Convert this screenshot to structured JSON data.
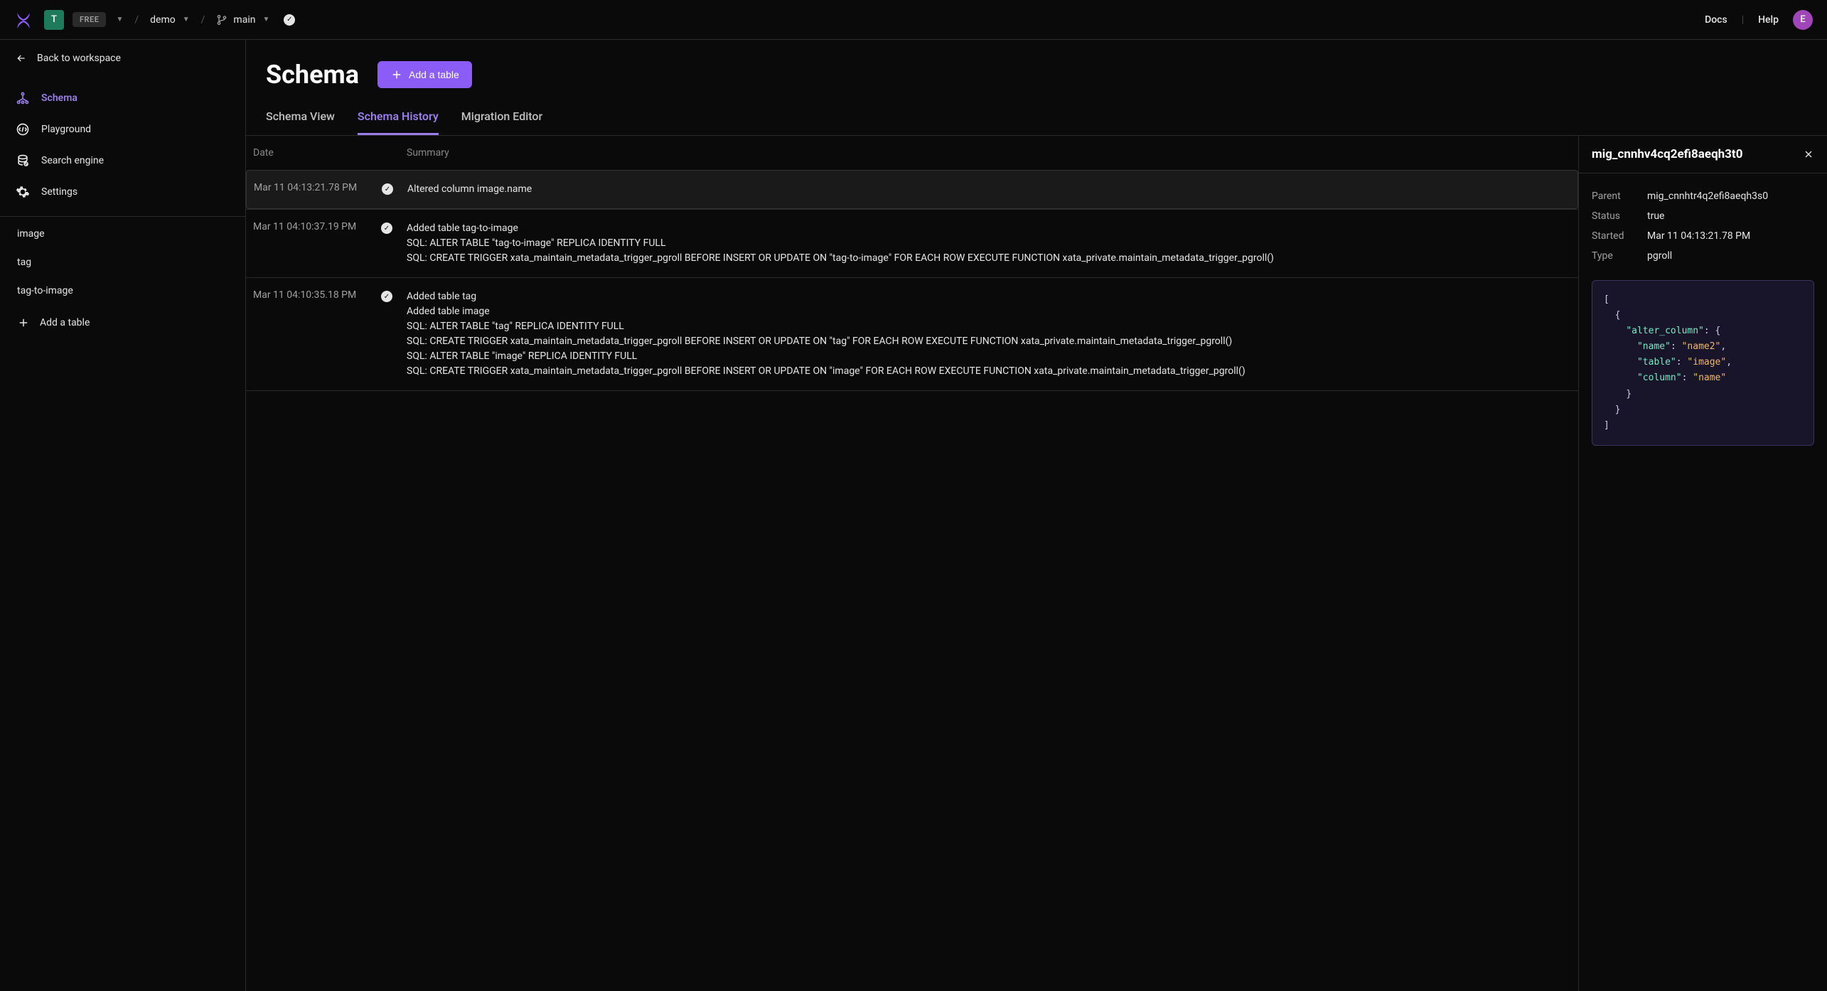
{
  "topbar": {
    "workspace_initial": "T",
    "plan": "FREE",
    "database": "demo",
    "branch": "main",
    "docs": "Docs",
    "help": "Help",
    "avatar_initial": "E"
  },
  "sidebar": {
    "back": "Back to workspace",
    "nav": [
      {
        "id": "schema",
        "label": "Schema",
        "active": true
      },
      {
        "id": "playground",
        "label": "Playground",
        "active": false
      },
      {
        "id": "search",
        "label": "Search engine",
        "active": false
      },
      {
        "id": "settings",
        "label": "Settings",
        "active": false
      }
    ],
    "tables": [
      "image",
      "tag",
      "tag-to-image"
    ],
    "add_table": "Add a table"
  },
  "main": {
    "title": "Schema",
    "add_table_btn": "Add a table",
    "tabs": [
      {
        "id": "view",
        "label": "Schema View",
        "active": false
      },
      {
        "id": "history",
        "label": "Schema History",
        "active": true
      },
      {
        "id": "migration",
        "label": "Migration Editor",
        "active": false
      }
    ]
  },
  "history": {
    "headers": {
      "date": "Date",
      "summary": "Summary"
    },
    "rows": [
      {
        "date": "Mar 11 04:13:21.78 PM",
        "summary": "Altered column image.name",
        "selected": true
      },
      {
        "date": "Mar 11 04:10:37.19 PM",
        "summary": "Added table tag-to-image\nSQL: ALTER TABLE \"tag-to-image\" REPLICA IDENTITY FULL\nSQL: CREATE TRIGGER xata_maintain_metadata_trigger_pgroll BEFORE INSERT OR UPDATE ON \"tag-to-image\" FOR EACH ROW EXECUTE FUNCTION xata_private.maintain_metadata_trigger_pgroll()",
        "selected": false
      },
      {
        "date": "Mar 11 04:10:35.18 PM",
        "summary": "Added table tag\nAdded table image\nSQL: ALTER TABLE \"tag\" REPLICA IDENTITY FULL\nSQL: CREATE TRIGGER xata_maintain_metadata_trigger_pgroll BEFORE INSERT OR UPDATE ON \"tag\" FOR EACH ROW EXECUTE FUNCTION xata_private.maintain_metadata_trigger_pgroll()\nSQL: ALTER TABLE \"image\" REPLICA IDENTITY FULL\nSQL: CREATE TRIGGER xata_maintain_metadata_trigger_pgroll BEFORE INSERT OR UPDATE ON \"image\" FOR EACH ROW EXECUTE FUNCTION xata_private.maintain_metadata_trigger_pgroll()",
        "selected": false
      }
    ]
  },
  "detail": {
    "title": "mig_cnnhv4cq2efi8aeqh3t0",
    "props": [
      {
        "label": "Parent",
        "value": "mig_cnnhtr4q2efi8aeqh3s0"
      },
      {
        "label": "Status",
        "value": "true"
      },
      {
        "label": "Started",
        "value": "Mar 11 04:13:21.78 PM"
      },
      {
        "label": "Type",
        "value": "pgroll"
      }
    ],
    "code_tokens": [
      {
        "t": "punc",
        "v": "["
      },
      {
        "t": "nl"
      },
      {
        "t": "pad",
        "v": "  "
      },
      {
        "t": "punc",
        "v": "{"
      },
      {
        "t": "nl"
      },
      {
        "t": "pad",
        "v": "    "
      },
      {
        "t": "key",
        "v": "\"alter_column\""
      },
      {
        "t": "punc",
        "v": ": {"
      },
      {
        "t": "nl"
      },
      {
        "t": "pad",
        "v": "      "
      },
      {
        "t": "key",
        "v": "\"name\""
      },
      {
        "t": "punc",
        "v": ": "
      },
      {
        "t": "str",
        "v": "\"name2\""
      },
      {
        "t": "punc",
        "v": ","
      },
      {
        "t": "nl"
      },
      {
        "t": "pad",
        "v": "      "
      },
      {
        "t": "key",
        "v": "\"table\""
      },
      {
        "t": "punc",
        "v": ": "
      },
      {
        "t": "str",
        "v": "\"image\""
      },
      {
        "t": "punc",
        "v": ","
      },
      {
        "t": "nl"
      },
      {
        "t": "pad",
        "v": "      "
      },
      {
        "t": "key",
        "v": "\"column\""
      },
      {
        "t": "punc",
        "v": ": "
      },
      {
        "t": "str",
        "v": "\"name\""
      },
      {
        "t": "nl"
      },
      {
        "t": "pad",
        "v": "    "
      },
      {
        "t": "punc",
        "v": "}"
      },
      {
        "t": "nl"
      },
      {
        "t": "pad",
        "v": "  "
      },
      {
        "t": "punc",
        "v": "}"
      },
      {
        "t": "nl"
      },
      {
        "t": "punc",
        "v": "]"
      }
    ]
  }
}
